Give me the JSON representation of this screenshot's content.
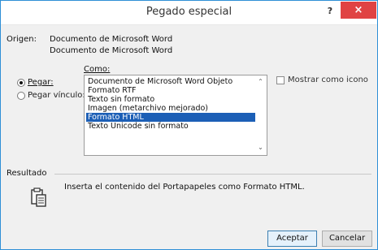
{
  "window": {
    "title": "Pegado especial",
    "help": "?",
    "close": "×"
  },
  "origin": {
    "label": "Origen:",
    "line1": "Documento de Microsoft Word",
    "line2": "Documento de Microsoft Word"
  },
  "como_label": "Como:",
  "paste_options": [
    {
      "label": "Pegar:",
      "checked": true
    },
    {
      "label": "Pegar vínculo:",
      "checked": false
    }
  ],
  "formats": [
    "Documento de Microsoft Word Objeto",
    "Formato RTF",
    "Texto sin formato",
    "Imagen (metarchivo mejorado)",
    "Formato HTML",
    "Texto Unicode sin formato"
  ],
  "selected_format_index": 4,
  "show_as_icon": {
    "label": "Mostrar como icono",
    "checked": false
  },
  "result": {
    "label": "Resultado",
    "text": "Inserta el contenido del Portapapeles como Formato HTML."
  },
  "buttons": {
    "ok": "Aceptar",
    "cancel": "Cancelar"
  },
  "colors": {
    "selection": "#1c5fb6",
    "close": "#e04343",
    "border": "#2e8fd6"
  }
}
